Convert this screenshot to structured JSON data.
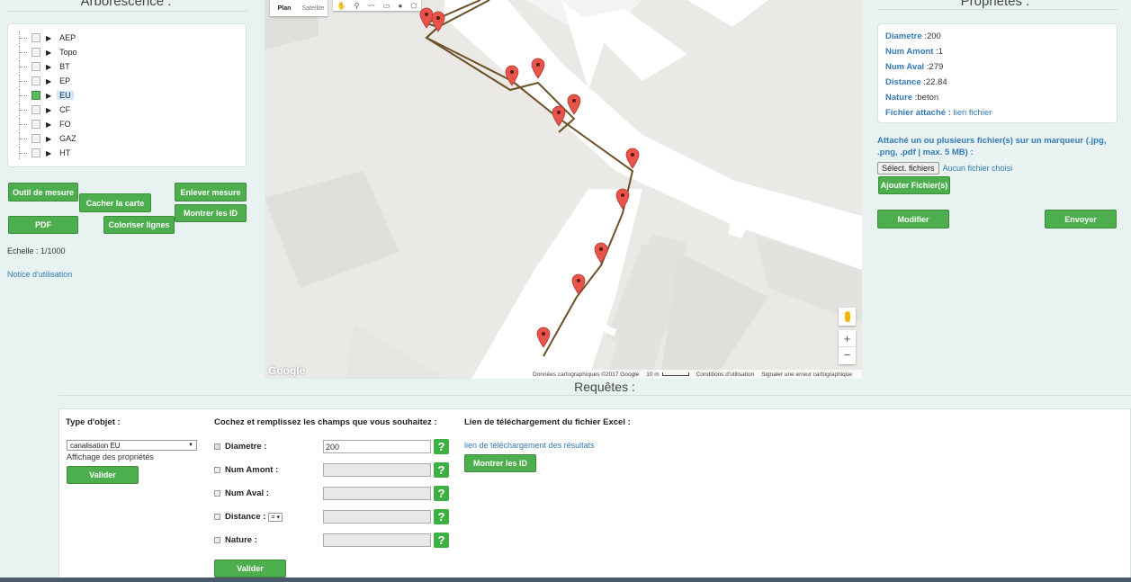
{
  "left": {
    "title": "Arborescence :",
    "tree": [
      {
        "label": "AEP",
        "checked": false
      },
      {
        "label": "Topo",
        "checked": false
      },
      {
        "label": "BT",
        "checked": false
      },
      {
        "label": "EP",
        "checked": false
      },
      {
        "label": "EU",
        "checked": true
      },
      {
        "label": "CF",
        "checked": false
      },
      {
        "label": "FO",
        "checked": false
      },
      {
        "label": "GAZ",
        "checked": false
      },
      {
        "label": "HT",
        "checked": false
      }
    ],
    "buttons": {
      "outil_mesure": "Outil de mesure",
      "cacher_carte": "Cacher la carte",
      "enlever_mesure": "Enlever mesure",
      "montrer_id": "Montrer les ID",
      "pdf": "PDF",
      "coloriser": "Coloriser lignes"
    },
    "echelle": "Echelle : 1/1000",
    "notice": "Notice d'utilisation"
  },
  "map": {
    "tab_plan": "Plan",
    "tab_satellite": "Satellite",
    "google": "Google",
    "attribution": "Données cartographiques ©2017 Google",
    "scale": "10 m",
    "conditions": "Conditions d'utilisation",
    "report": "Signaler une erreur cartographique",
    "zoom_in": "+",
    "zoom_out": "−"
  },
  "right": {
    "title": "Propriétés :",
    "props": [
      {
        "key": "Diametre",
        "value": "200"
      },
      {
        "key": "Num Amont",
        "value": "1"
      },
      {
        "key": "Num Aval",
        "value": "279"
      },
      {
        "key": "Distance",
        "value": "22.84"
      },
      {
        "key": "Nature",
        "value": "beton"
      }
    ],
    "fichier_key": "Fichier attaché :",
    "fichier_link": "lien fichier",
    "attach_text": "Attaché un ou plusieurs fichier(s) sur un marqueur (.jpg, .png, .pdf | max. 5 MB) :",
    "select_btn": "Sélect. fichiers",
    "no_file": "Aucun fichier choisi",
    "ajouter": "Ajouter Fichier(s)",
    "modifier": "Modifier",
    "envoyer": "Envoyer"
  },
  "requetes": {
    "title": "Requêtes :",
    "type_label": "Type d'objet :",
    "type_value": "canalisation EU",
    "affichage": "Affichage des propriétés",
    "valider1": "Valider",
    "cochez": "Cochez et remplissez les champs que vous souhaitez :",
    "fields": [
      {
        "label": "Diametre :",
        "value": "200",
        "checked": true
      },
      {
        "label": "Num Amont :",
        "value": "",
        "checked": false
      },
      {
        "label": "Num Aval :",
        "value": "",
        "checked": false
      },
      {
        "label": "Distance :",
        "value": "",
        "checked": false,
        "op": "="
      },
      {
        "label": "Nature :",
        "value": "",
        "checked": false
      }
    ],
    "help": "?",
    "valider2": "Valider",
    "excel_label": "Lien de téléchargement du fichier Excel :",
    "excel_link": "lien de téléchargement des résultats",
    "montrer_id": "Montrer les ID"
  },
  "colors": {
    "accent_green": "#4cae4c",
    "link_blue": "#337ab7",
    "pipe": "#6b5127",
    "marker": "#e8534a"
  }
}
